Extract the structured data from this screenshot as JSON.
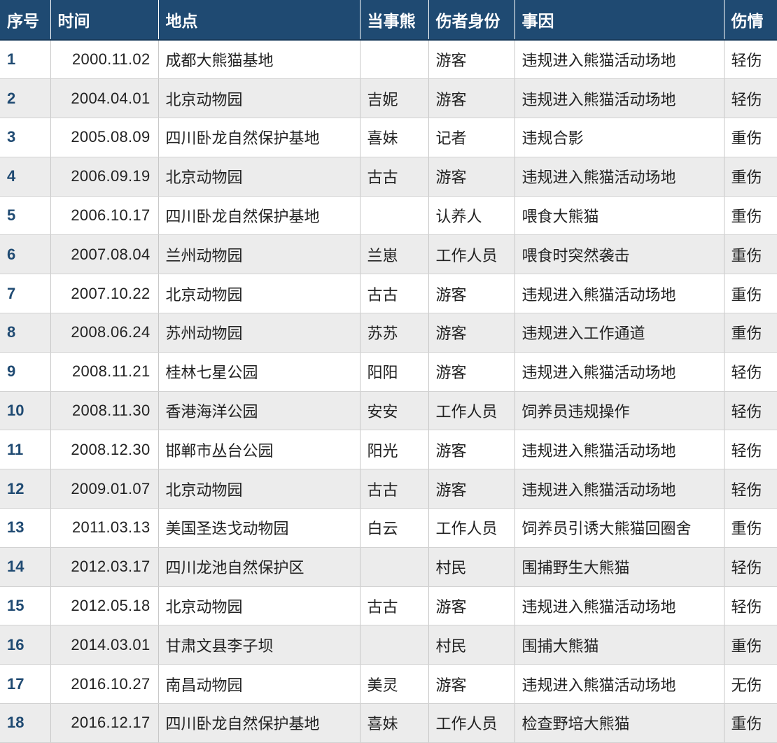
{
  "headers": [
    "序号",
    "时间",
    "地点",
    "当事熊",
    "伤者身份",
    "事因",
    "伤情"
  ],
  "rows": [
    [
      "1",
      "2000.11.02",
      "成都大熊猫基地",
      "",
      "游客",
      "违规进入熊猫活动场地",
      "轻伤"
    ],
    [
      "2",
      "2004.04.01",
      "北京动物园",
      "吉妮",
      "游客",
      "违规进入熊猫活动场地",
      "轻伤"
    ],
    [
      "3",
      "2005.08.09",
      "四川卧龙自然保护基地",
      "喜妹",
      "记者",
      "违规合影",
      "重伤"
    ],
    [
      "4",
      "2006.09.19",
      "北京动物园",
      "古古",
      "游客",
      "违规进入熊猫活动场地",
      "重伤"
    ],
    [
      "5",
      "2006.10.17",
      "四川卧龙自然保护基地",
      "",
      "认养人",
      "喂食大熊猫",
      "重伤"
    ],
    [
      "6",
      "2007.08.04",
      "兰州动物园",
      "兰崽",
      "工作人员",
      "喂食时突然袭击",
      "重伤"
    ],
    [
      "7",
      "2007.10.22",
      "北京动物园",
      "古古",
      "游客",
      "违规进入熊猫活动场地",
      "重伤"
    ],
    [
      "8",
      "2008.06.24",
      "苏州动物园",
      "苏苏",
      "游客",
      "违规进入工作通道",
      "重伤"
    ],
    [
      "9",
      "2008.11.21",
      "桂林七星公园",
      "阳阳",
      "游客",
      "违规进入熊猫活动场地",
      "轻伤"
    ],
    [
      "10",
      "2008.11.30",
      "香港海洋公园",
      "安安",
      "工作人员",
      "饲养员违规操作",
      "轻伤"
    ],
    [
      "11",
      "2008.12.30",
      "邯郸市丛台公园",
      "阳光",
      "游客",
      "违规进入熊猫活动场地",
      "轻伤"
    ],
    [
      "12",
      "2009.01.07",
      "北京动物园",
      "古古",
      "游客",
      "违规进入熊猫活动场地",
      "轻伤"
    ],
    [
      "13",
      "2011.03.13",
      "美国圣迭戈动物园",
      "白云",
      "工作人员",
      "饲养员引诱大熊猫回圈舍",
      "重伤"
    ],
    [
      "14",
      "2012.03.17",
      "四川龙池自然保护区",
      "",
      "村民",
      "围捕野生大熊猫",
      "轻伤"
    ],
    [
      "15",
      "2012.05.18",
      "北京动物园",
      "古古",
      "游客",
      "违规进入熊猫活动场地",
      "轻伤"
    ],
    [
      "16",
      "2014.03.01",
      "甘肃文县李子坝",
      "",
      "村民",
      "围捕大熊猫",
      "重伤"
    ],
    [
      "17",
      "2016.10.27",
      "南昌动物园",
      "美灵",
      "游客",
      "违规进入熊猫活动场地",
      "无伤"
    ],
    [
      "18",
      "2016.12.17",
      "四川卧龙自然保护基地",
      "喜妹",
      "工作人员",
      "检查野培大熊猫",
      "重伤"
    ]
  ]
}
